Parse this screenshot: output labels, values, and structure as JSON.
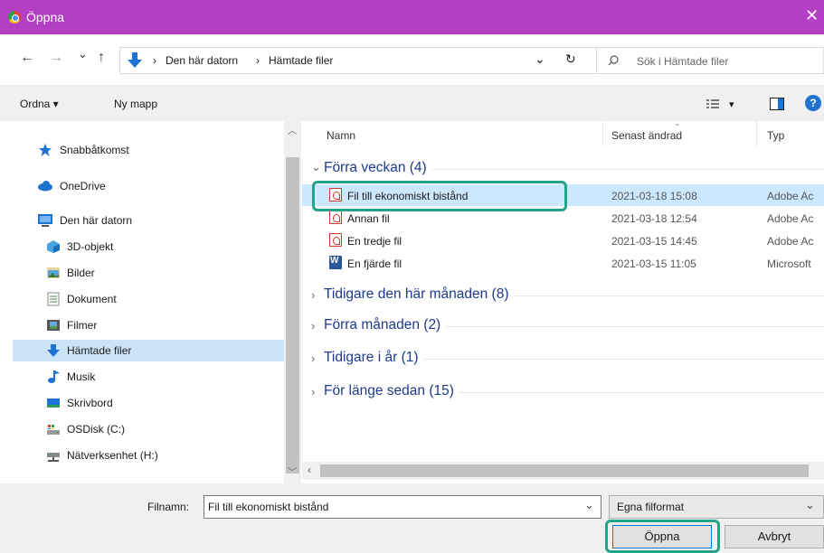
{
  "window": {
    "title": "Öppna",
    "close_glyph": "✕"
  },
  "nav_buttons": {
    "back": "←",
    "forward": "→",
    "recent": "⌄",
    "up": "↑"
  },
  "address": {
    "crumbs": [
      "Den här datorn",
      "Hämtade filer"
    ],
    "separator": "›",
    "dropdown": "⌄",
    "refresh": "↻"
  },
  "search": {
    "placeholder": "Sök i Hämtade filer"
  },
  "commands": {
    "organize": "Ordna ▾",
    "new_folder": "Ny mapp",
    "view_arrow": "▾",
    "help": "?"
  },
  "sidebar": {
    "items": [
      {
        "label": "Snabbåtkomst",
        "icon": "star-icon"
      },
      {
        "label": "OneDrive",
        "icon": "cloud-icon"
      },
      {
        "label": "Den här datorn",
        "icon": "computer-icon"
      },
      {
        "label": "3D-objekt",
        "icon": "cube-icon"
      },
      {
        "label": "Bilder",
        "icon": "pictures-icon"
      },
      {
        "label": "Dokument",
        "icon": "documents-icon"
      },
      {
        "label": "Filmer",
        "icon": "film-icon"
      },
      {
        "label": "Hämtade filer",
        "icon": "download-icon"
      },
      {
        "label": "Musik",
        "icon": "music-icon"
      },
      {
        "label": "Skrivbord",
        "icon": "desktop-icon"
      },
      {
        "label": "OSDisk (C:)",
        "icon": "disk-icon"
      },
      {
        "label": "Nätverksenhet (H:)",
        "icon": "network-drive-icon"
      }
    ]
  },
  "columns": {
    "name": "Namn",
    "modified": "Senast ändrad",
    "type": "Typ"
  },
  "groups": [
    {
      "label": "Förra veckan (4)",
      "expanded": true
    },
    {
      "label": "Tidigare den här månaden (8)",
      "expanded": false
    },
    {
      "label": "Förra månaden (2)",
      "expanded": false
    },
    {
      "label": "Tidigare i år (1)",
      "expanded": false
    },
    {
      "label": "För länge sedan (15)",
      "expanded": false
    }
  ],
  "files": [
    {
      "name": "Fil till ekonomiskt bistånd",
      "modified": "2021-03-18 15:08",
      "type": "Adobe Ac",
      "icon": "pdf-icon"
    },
    {
      "name": "Annan fil",
      "modified": "2021-03-18 12:54",
      "type": "Adobe Ac",
      "icon": "pdf-icon"
    },
    {
      "name": "En tredje fil",
      "modified": "2021-03-15 14:45",
      "type": "Adobe Ac",
      "icon": "pdf-icon"
    },
    {
      "name": "En fjärde fil",
      "modified": "2021-03-15 11:05",
      "type": "Microsoft",
      "icon": "word-icon"
    }
  ],
  "bottom": {
    "filename_label": "Filnamn:",
    "filename_value": "Fil till ekonomiskt bistånd",
    "filetype_value": "Egna filformat",
    "open": "Öppna",
    "cancel": "Avbryt"
  },
  "colors": {
    "titlebar": "#b53fc4",
    "highlight": "#22a38a",
    "selected": "#cce8ff",
    "group_text": "#1e3a8a"
  }
}
